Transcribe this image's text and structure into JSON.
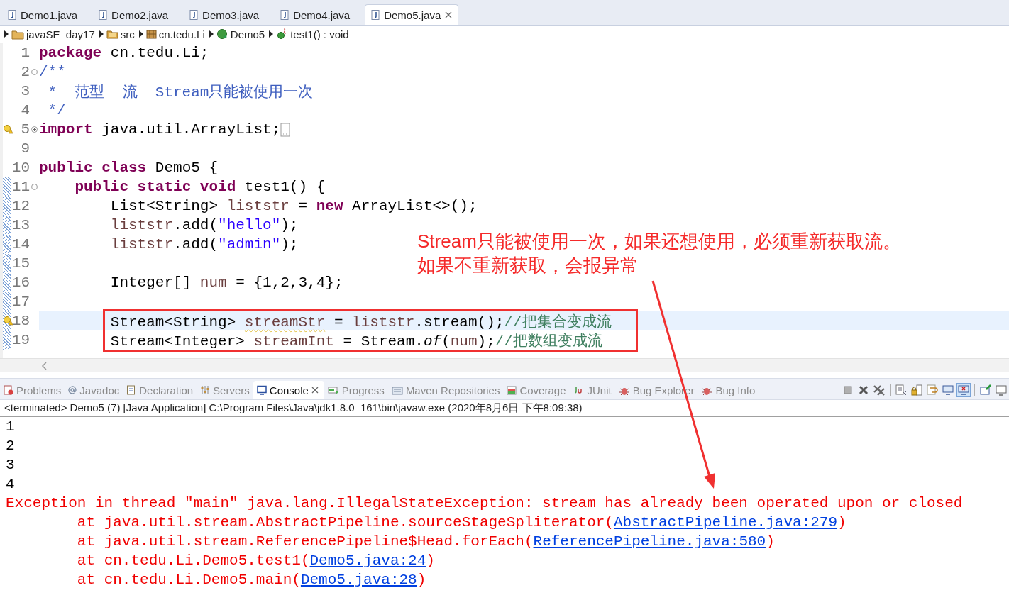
{
  "editor_tabs": [
    {
      "label": "Demo1.java",
      "selected": false
    },
    {
      "label": "Demo2.java",
      "selected": false
    },
    {
      "label": "Demo3.java",
      "selected": false
    },
    {
      "label": "Demo4.java",
      "selected": false
    },
    {
      "label": "Demo5.java",
      "selected": true
    }
  ],
  "breadcrumb": [
    {
      "label": "javaSE_day17",
      "kind": "project"
    },
    {
      "label": "src",
      "kind": "folder"
    },
    {
      "label": "cn.tedu.Li",
      "kind": "package"
    },
    {
      "label": "Demo5",
      "kind": "class"
    },
    {
      "label": "test1() : void",
      "kind": "method"
    }
  ],
  "code_lines": [
    {
      "num": "1",
      "tokens": [
        {
          "kind": "kw",
          "text": "package"
        },
        {
          "kind": "p",
          "text": " cn.tedu.Li;"
        }
      ]
    },
    {
      "num": "2",
      "expanded": true,
      "tokens": [
        {
          "kind": "doc",
          "text": "/**"
        }
      ]
    },
    {
      "num": "3",
      "tokens": [
        {
          "kind": "doc",
          "text": " *  范型  流  Stream只能被使用一次"
        }
      ]
    },
    {
      "num": "4",
      "tokens": [
        {
          "kind": "doc",
          "text": " */"
        }
      ]
    },
    {
      "num": "5",
      "expanded": false,
      "warning": true,
      "tokens": [
        {
          "kind": "kw",
          "text": "import"
        },
        {
          "kind": "p",
          "text": " java.util.ArrayList;"
        }
      ]
    },
    {
      "num": "9"
    },
    {
      "num": "10",
      "tokens": [
        {
          "kind": "kw",
          "text": "public class"
        },
        {
          "kind": "p",
          "text": " Demo5 {"
        }
      ]
    },
    {
      "num": "11",
      "expanded": true,
      "changed": true,
      "tokens": [
        {
          "kind": "kw",
          "text": "    public static void"
        },
        {
          "kind": "p",
          "text": " test1() {"
        }
      ]
    },
    {
      "num": "12",
      "changed": true,
      "tokens": [
        {
          "kind": "p",
          "text": "        List<String> "
        },
        {
          "kind": "var",
          "text": "liststr"
        },
        {
          "kind": "p",
          "text": " = "
        },
        {
          "kind": "kw",
          "text": "new"
        },
        {
          "kind": "p",
          "text": " ArrayList<>();"
        }
      ]
    },
    {
      "num": "13",
      "changed": true,
      "tokens": [
        {
          "kind": "var",
          "text": "        liststr"
        },
        {
          "kind": "p",
          "text": ".add("
        },
        {
          "kind": "str",
          "text": "\"hello\""
        },
        {
          "kind": "p",
          "text": ");"
        }
      ]
    },
    {
      "num": "14",
      "changed": true,
      "tokens": [
        {
          "kind": "var",
          "text": "        liststr"
        },
        {
          "kind": "p",
          "text": ".add("
        },
        {
          "kind": "str",
          "text": "\"admin\""
        },
        {
          "kind": "p",
          "text": ");"
        }
      ]
    },
    {
      "num": "15",
      "changed": true
    },
    {
      "num": "16",
      "changed": true,
      "tokens": [
        {
          "kind": "p",
          "text": "        Integer[] "
        },
        {
          "kind": "var",
          "text": "num"
        },
        {
          "kind": "p",
          "text": " = {1,2,3,4};"
        }
      ]
    },
    {
      "num": "17",
      "changed": true
    },
    {
      "num": "18",
      "changed": true,
      "warning": true,
      "current": true,
      "boxed": true,
      "tokens": [
        {
          "kind": "p",
          "text": "        Stream<String> "
        },
        {
          "kind": "warnvar",
          "text": "streamStr"
        },
        {
          "kind": "p",
          "text": " = "
        },
        {
          "kind": "var",
          "text": "liststr"
        },
        {
          "kind": "p",
          "text": ".stream();"
        },
        {
          "kind": "cmt",
          "text": "//把集合变成流"
        }
      ]
    },
    {
      "num": "19",
      "changed": true,
      "boxed": true,
      "tokens": [
        {
          "kind": "p",
          "text": "        Stream<Integer> "
        },
        {
          "kind": "var",
          "text": "streamInt"
        },
        {
          "kind": "p",
          "text": " = Stream."
        },
        {
          "kind": "it",
          "text": "of"
        },
        {
          "kind": "p",
          "text": "("
        },
        {
          "kind": "var",
          "text": "num"
        },
        {
          "kind": "p",
          "text": ");"
        },
        {
          "kind": "cmt",
          "text": "//把数组变成流"
        }
      ]
    }
  ],
  "annotation": [
    "Stream只能被使用一次，如果还想使用，必须重新获取流。",
    "如果不重新获取，会报异常"
  ],
  "view_tabs": [
    {
      "label": "Problems",
      "selected": false
    },
    {
      "label": "Javadoc",
      "selected": false
    },
    {
      "label": "Declaration",
      "selected": false
    },
    {
      "label": "Servers",
      "selected": false
    },
    {
      "label": "Console",
      "selected": true
    },
    {
      "label": "Progress",
      "selected": false
    },
    {
      "label": "Maven Repositories",
      "selected": false
    },
    {
      "label": "Coverage",
      "selected": false
    },
    {
      "label": "JUnit",
      "selected": false
    },
    {
      "label": "Bug Explorer",
      "selected": false
    },
    {
      "label": "Bug Info",
      "selected": false
    }
  ],
  "console_toolbar": [
    {
      "kind": "stop",
      "selected": false
    },
    {
      "kind": "remove",
      "selected": false
    },
    {
      "kind": "remove-all",
      "selected": false
    },
    {
      "kind": "clear",
      "selected": false
    },
    {
      "kind": "lock",
      "selected": false
    },
    {
      "kind": "wrap",
      "selected": false
    },
    {
      "kind": "out",
      "selected": false
    },
    {
      "kind": "err",
      "selected": true
    },
    {
      "kind": "pin",
      "selected": false
    },
    {
      "kind": "display",
      "selected": false
    }
  ],
  "console_status": "<terminated> Demo5 (7) [Java Application] C:\\Program Files\\Java\\jdk1.8.0_161\\bin\\javaw.exe (2020年8月6日 下午8:09:38)",
  "console_output": [
    {
      "kind": "out",
      "text": "1"
    },
    {
      "kind": "out",
      "text": "2"
    },
    {
      "kind": "out",
      "text": "3"
    },
    {
      "kind": "out",
      "text": "4"
    },
    {
      "kind": "err",
      "text": "Exception in thread \"main\" java.lang.IllegalStateException: stream has already been operated upon or closed"
    },
    {
      "kind": "trace",
      "text": "\tat java.util.stream.AbstractPipeline.sourceStageSpliterator(",
      "link": "AbstractPipeline.java:279",
      "after": ")"
    },
    {
      "kind": "trace",
      "text": "\tat java.util.stream.ReferencePipeline$Head.forEach(",
      "link": "ReferencePipeline.java:580",
      "after": ")"
    },
    {
      "kind": "trace",
      "text": "\tat cn.tedu.Li.Demo5.test1(",
      "link": "Demo5.java:24",
      "after": ")"
    },
    {
      "kind": "trace",
      "text": "\tat cn.tedu.Li.Demo5.main(",
      "link": "Demo5.java:28",
      "after": ")"
    }
  ]
}
